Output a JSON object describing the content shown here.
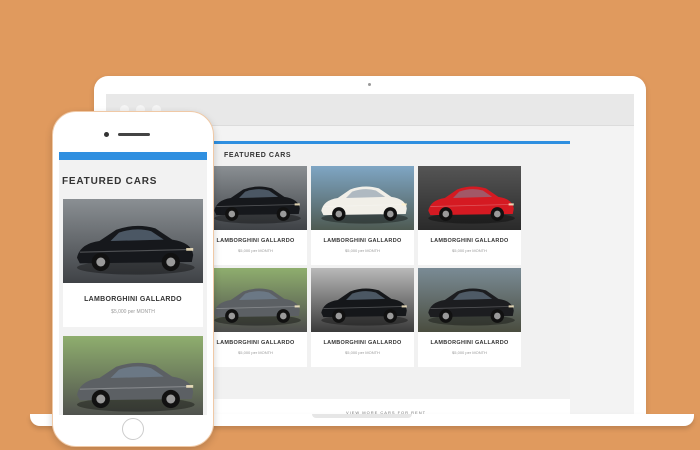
{
  "laptop": {
    "section_title": "FEATURED CARS",
    "cards": [
      {
        "name": "LAMBORGHINI GALLARDO",
        "price": "$5,000 per MONTH",
        "image": "black-coupe-road",
        "car_color": "#16181c",
        "bg_top": "#8a8f93",
        "bg_bottom": "#3f4246"
      },
      {
        "name": "LAMBORGHINI GALLARDO",
        "price": "$5,000 per MONTH",
        "image": "white-coupe-coast",
        "car_color": "#f1efe8",
        "bg_top": "#7fa6c4",
        "bg_bottom": "#4e5a52"
      },
      {
        "name": "LAMBORGHINI GALLARDO",
        "price": "$5,000 per MONTH",
        "image": "red-sports-car",
        "car_color": "#d51a22",
        "bg_top": "#555555",
        "bg_bottom": "#2a2a2a"
      },
      {
        "name": "LAMBORGHINI GALLARDO",
        "price": "$5,000 per MONTH",
        "image": "silver-sedan-street",
        "car_color": "#5c6064",
        "bg_top": "#8fae6e",
        "bg_bottom": "#4c4c4c"
      },
      {
        "name": "LAMBORGHINI GALLARDO",
        "price": "$5,000 per MONTH",
        "image": "black-sports-car",
        "car_color": "#15171a",
        "bg_top": "#b9b9b9",
        "bg_bottom": "#3a3a3a"
      },
      {
        "name": "LAMBORGHINI GALLARDO",
        "price": "$5,000 per MONTH",
        "image": "black-coupe-field",
        "car_color": "#1c1d20",
        "bg_top": "#7a8b95",
        "bg_bottom": "#4a4d3f"
      }
    ],
    "footer_text": "VIEW MORE CARS FOR RENT"
  },
  "phone": {
    "section_title": "FEATURED CARS",
    "cards": [
      {
        "name": "LAMBORGHINI GALLARDO",
        "price": "$5,000 per MONTH",
        "image": "black-coupe-road",
        "car_color": "#16181c",
        "bg_top": "#8a8f93",
        "bg_bottom": "#3f4246"
      },
      {
        "name": "",
        "price": "",
        "image": "silver-sedan-street",
        "car_color": "#5c6064",
        "bg_top": "#8fae6e",
        "bg_bottom": "#4c4c4c"
      }
    ]
  },
  "colors": {
    "background": "#e09a5e",
    "accent": "#2f8fe0",
    "device": "#ffffff"
  }
}
